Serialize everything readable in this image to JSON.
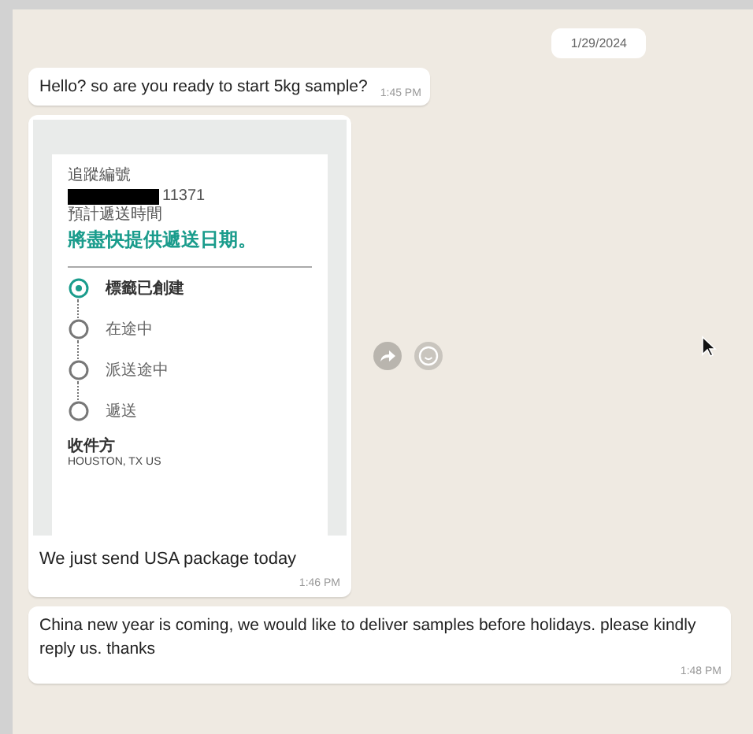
{
  "date": "1/29/2024",
  "messages": [
    {
      "kind": "text",
      "text": "Hello? so are you ready to start 5kg sample?",
      "time": "1:45 PM"
    },
    {
      "kind": "image",
      "screenshot": {
        "tracking_label": "追蹤編號",
        "tracking_number": "11371",
        "delivery_label": "預計遞送時間",
        "delivery_text": "將盡快提供遞送日期。",
        "steps": [
          {
            "label": "標籤已創建",
            "active": true
          },
          {
            "label": "在途中",
            "active": false
          },
          {
            "label": "派送途中",
            "active": false
          },
          {
            "label": "遞送",
            "active": false
          }
        ],
        "recipient_label": "收件方",
        "recipient_address": "HOUSTON, TX US"
      },
      "caption": "We just send USA package today",
      "time": "1:46 PM"
    },
    {
      "kind": "text",
      "text": "China new year is coming, we would like to deliver samples before holidays. please kindly reply us. thanks",
      "time": "1:48 PM"
    }
  ]
}
